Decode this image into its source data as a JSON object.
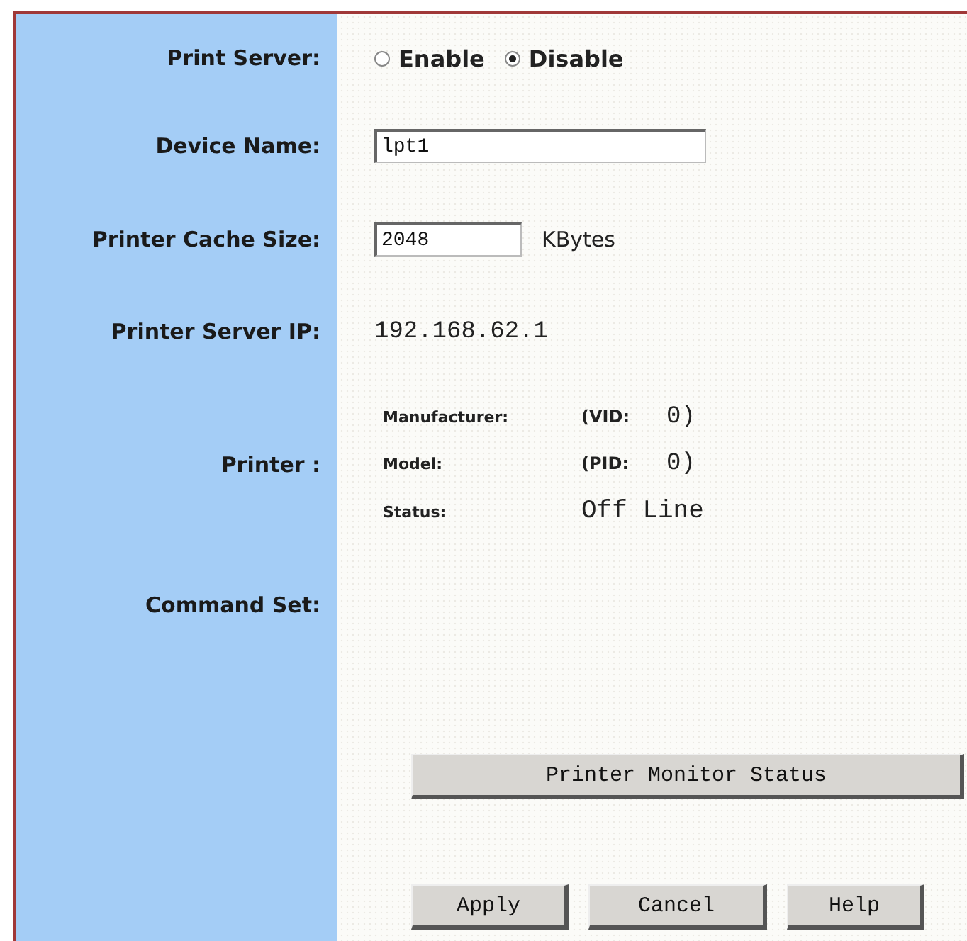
{
  "print_server": {
    "label": "Print Server:",
    "options": [
      {
        "label": "Enable",
        "selected": false
      },
      {
        "label": "Disable",
        "selected": true
      }
    ]
  },
  "device_name": {
    "label": "Device Name:",
    "value": "lpt1"
  },
  "cache_size": {
    "label": "Printer Cache Size:",
    "value": "2048",
    "unit": "KBytes"
  },
  "server_ip": {
    "label": "Printer Server IP:",
    "value": "192.168.62.1"
  },
  "printer": {
    "label": "Printer :",
    "details": [
      {
        "kind": "id",
        "label": "Manufacturer:",
        "id_label": "(VID:",
        "id_value": "0)"
      },
      {
        "kind": "id",
        "label": "Model:",
        "id_label": "(PID:",
        "id_value": "0)"
      },
      {
        "kind": "text",
        "label": "Status:",
        "value": "Off Line"
      }
    ]
  },
  "command_set": {
    "label": "Command Set:"
  },
  "monitor_button": "Printer Monitor Status",
  "buttons": [
    "Apply",
    "Cancel",
    "Help"
  ]
}
